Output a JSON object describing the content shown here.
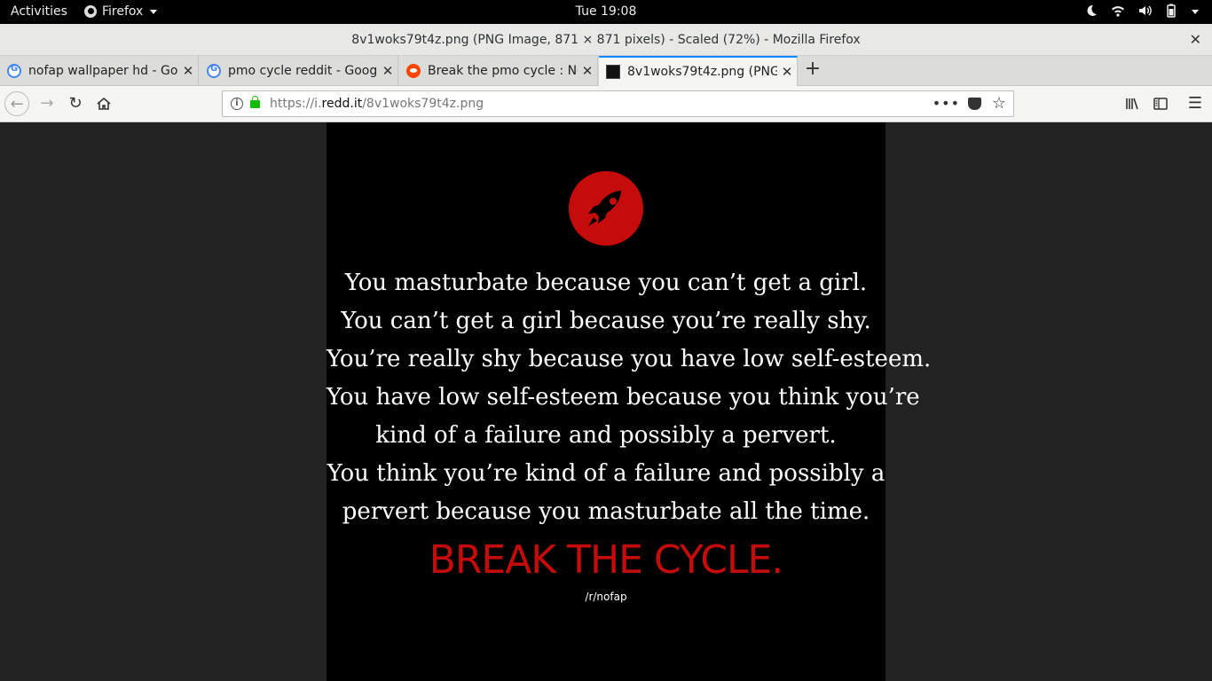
{
  "topbar": {
    "activities": "Activities",
    "app": "Firefox",
    "clock": "Tue 19:08"
  },
  "window": {
    "title": "8v1woks79t4z.png (PNG Image, 871 × 871 pixels) - Scaled (72%) - Mozilla Firefox"
  },
  "tabs": [
    {
      "label": "nofap wallpaper hd - Goo"
    },
    {
      "label": "pmo cycle reddit - Google"
    },
    {
      "label": "Break the pmo cycle : Nof"
    },
    {
      "label": "8v1woks79t4z.png (PNG"
    }
  ],
  "urlbar": {
    "prefix": "https://i.",
    "domain": "redd.it",
    "path": "/8v1woks79t4z.png"
  },
  "image": {
    "lines": [
      "You masturbate because you can’t get a girl.",
      "You can’t get a girl because you’re really shy.",
      "You’re really shy because you have low self-esteem.",
      "You have low self-esteem because you think you’re",
      "kind of a failure and possibly a pervert.",
      "You think you’re kind of a failure and possibly a",
      "pervert because you masturbate all the time."
    ],
    "cta": "BREAK THE CYCLE.",
    "subreddit": "/r/nofap"
  },
  "colors": {
    "accent_red": "#c60b0b",
    "tab_highlight": "#0a84ff"
  }
}
